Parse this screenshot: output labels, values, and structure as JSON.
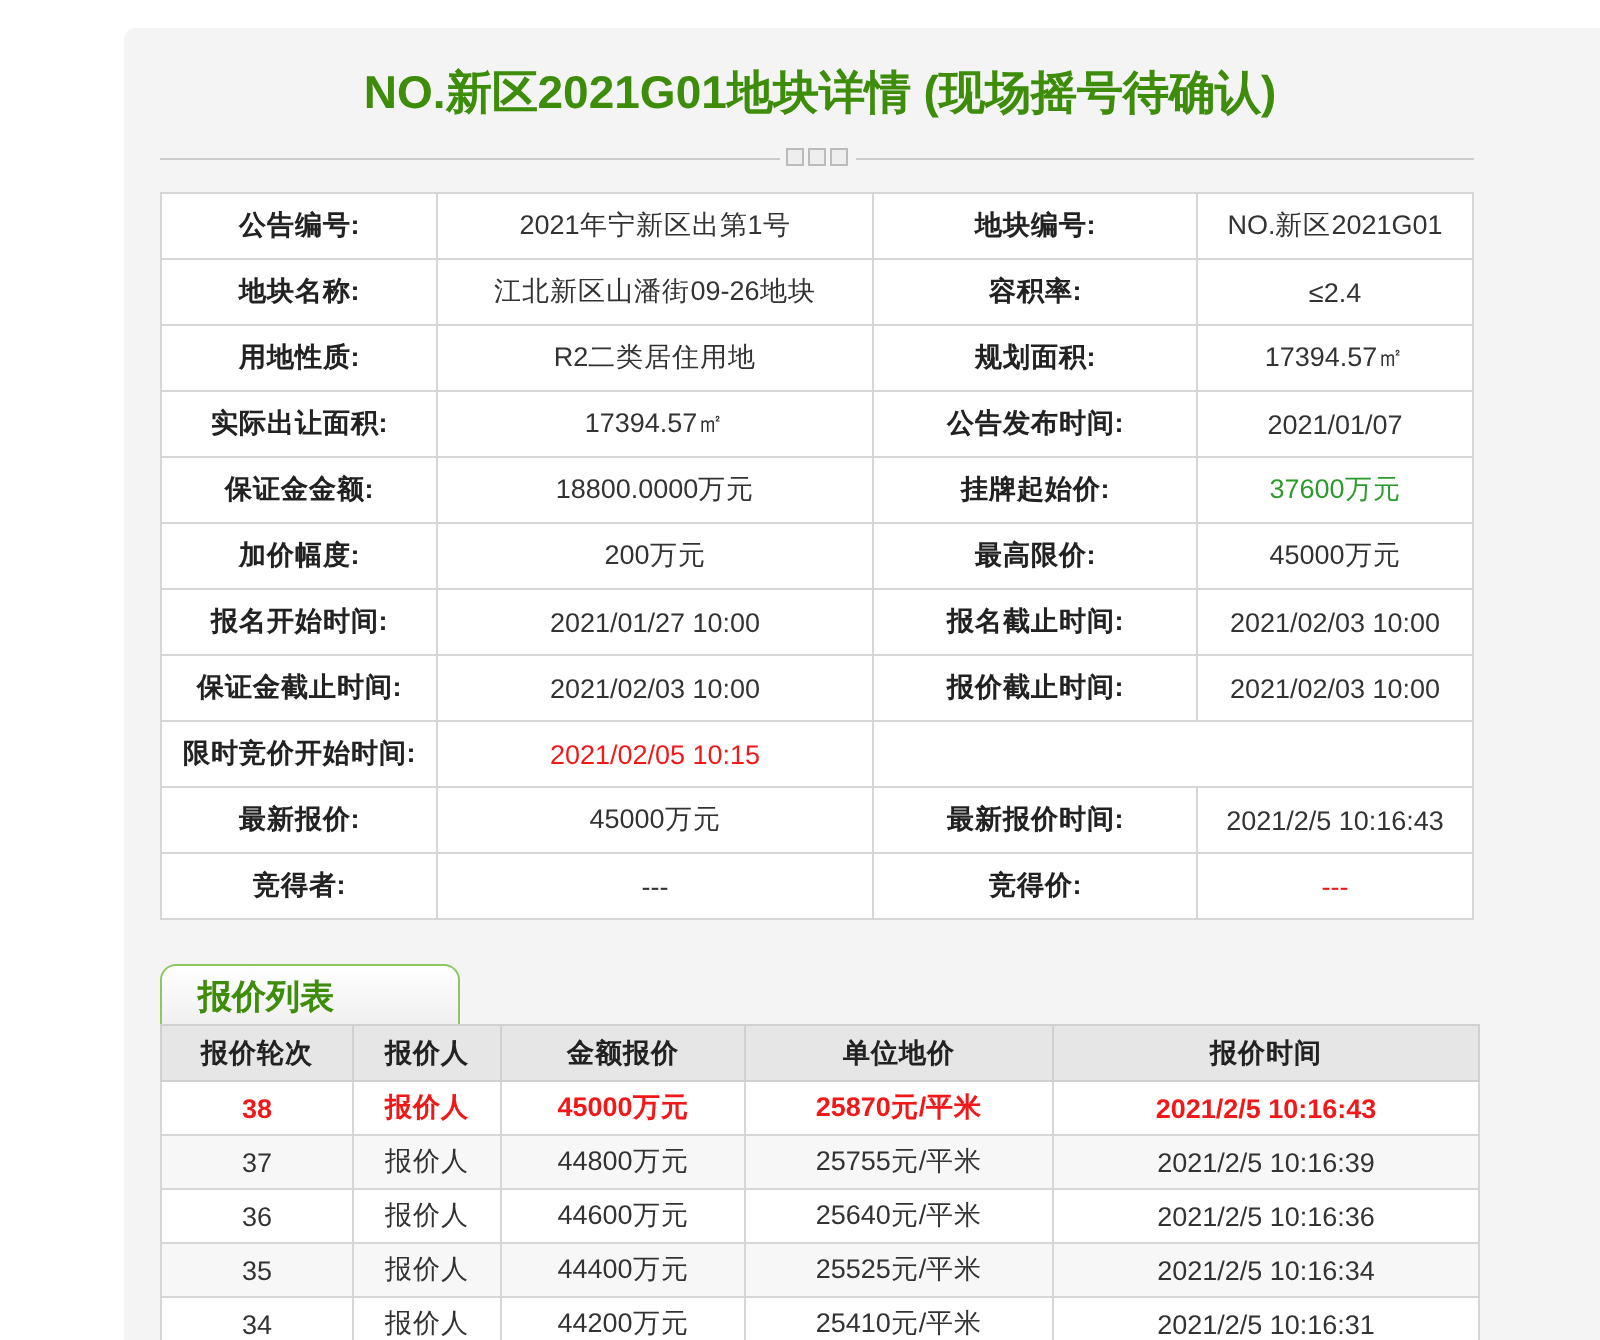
{
  "title": "NO.新区2021G01地块详情 (现场摇号待确认)",
  "details": [
    {
      "cells": [
        {
          "label": "公告编号:",
          "value": "2021年宁新区出第1号"
        },
        {
          "label": "地块编号:",
          "value": "NO.新区2021G01"
        }
      ]
    },
    {
      "cells": [
        {
          "label": "地块名称:",
          "value": "江北新区山潘街09-26地块"
        },
        {
          "label": "容积率:",
          "value": "≤2.4"
        }
      ]
    },
    {
      "cells": [
        {
          "label": "用地性质:",
          "value": "R2二类居住用地"
        },
        {
          "label": "规划面积:",
          "value": "17394.57㎡"
        }
      ]
    },
    {
      "cells": [
        {
          "label": "实际出让面积:",
          "value": "17394.57㎡"
        },
        {
          "label": "公告发布时间:",
          "value": "2021/01/07"
        }
      ]
    },
    {
      "cells": [
        {
          "label": "保证金金额:",
          "value": "18800.0000万元"
        },
        {
          "label": "挂牌起始价:",
          "value": "37600万元",
          "color": "#2d9a2d"
        }
      ]
    },
    {
      "cells": [
        {
          "label": "加价幅度:",
          "value": "200万元"
        },
        {
          "label": "最高限价:",
          "value": "45000万元"
        }
      ]
    },
    {
      "cells": [
        {
          "label": "报名开始时间:",
          "value": "2021/01/27 10:00"
        },
        {
          "label": "报名截止时间:",
          "value": "2021/02/03 10:00"
        }
      ]
    },
    {
      "cells": [
        {
          "label": "保证金截止时间:",
          "value": "2021/02/03 10:00"
        },
        {
          "label": "报价截止时间:",
          "value": "2021/02/03 10:00"
        }
      ]
    },
    {
      "cells": [
        {
          "label": "限时竞价开始时间:",
          "value": "2021/02/05 10:15",
          "color": "#f01818"
        }
      ]
    },
    {
      "cells": [
        {
          "label": "最新报价:",
          "value": "45000万元"
        },
        {
          "label": "最新报价时间:",
          "value": "2021/2/5 10:16:43"
        }
      ]
    },
    {
      "cells": [
        {
          "label": "竞得者:",
          "value": "---"
        },
        {
          "label": "竞得价:",
          "value": "---",
          "color": "#f01818"
        }
      ]
    }
  ],
  "bids": {
    "tab": "报价列表",
    "columns": [
      "报价轮次",
      "报价人",
      "金额报价",
      "单位地价",
      "报价时间"
    ],
    "rows": [
      {
        "latest": true,
        "cells": [
          "38",
          "报价人",
          "45000万元",
          "25870元/平米",
          "2021/2/5 10:16:43"
        ]
      },
      {
        "latest": false,
        "cells": [
          "37",
          "报价人",
          "44800万元",
          "25755元/平米",
          "2021/2/5 10:16:39"
        ]
      },
      {
        "latest": false,
        "cells": [
          "36",
          "报价人",
          "44600万元",
          "25640元/平米",
          "2021/2/5 10:16:36"
        ]
      },
      {
        "latest": false,
        "cells": [
          "35",
          "报价人",
          "44400万元",
          "25525元/平米",
          "2021/2/5 10:16:34"
        ]
      },
      {
        "latest": false,
        "cells": [
          "34",
          "报价人",
          "44200万元",
          "25410元/平米",
          "2021/2/5 10:16:31"
        ]
      }
    ]
  }
}
